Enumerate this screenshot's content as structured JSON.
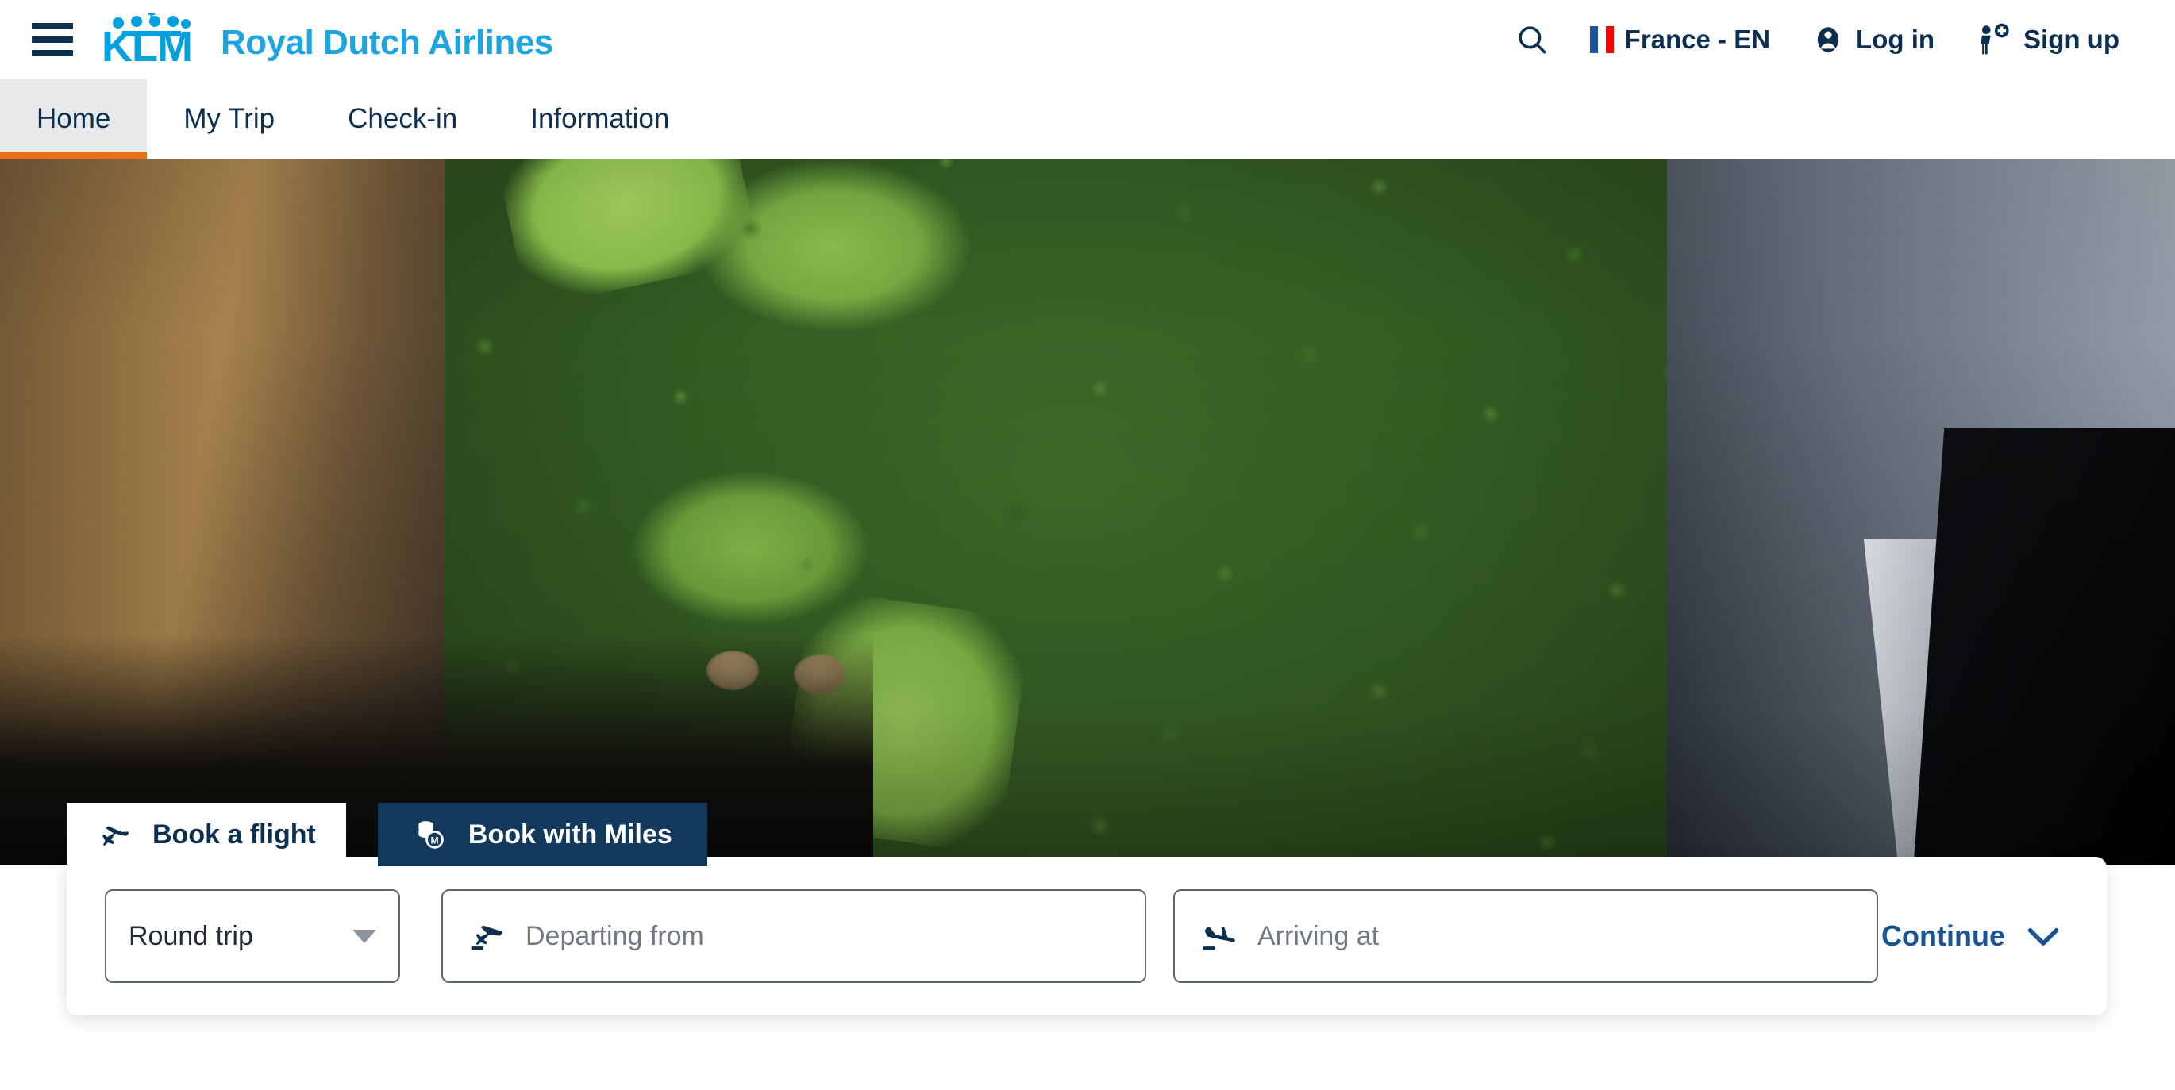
{
  "header": {
    "menu_icon": "hamburger-menu-icon",
    "logo": {
      "mark_text": "KLM",
      "brand_text": "Royal Dutch Airlines"
    },
    "search_icon": "search-icon",
    "locale": {
      "label": "France - EN",
      "flag": "france-flag-icon"
    },
    "login": {
      "label": "Log in",
      "icon": "user-account-icon"
    },
    "signup": {
      "label": "Sign up",
      "icon": "user-add-icon"
    }
  },
  "nav": {
    "tabs": [
      {
        "label": "Home",
        "active": true
      },
      {
        "label": "My Trip",
        "active": false
      },
      {
        "label": "Check-in",
        "active": false
      },
      {
        "label": "Information",
        "active": false
      }
    ]
  },
  "hero": {
    "alt": "Aerial view of Central Park and Manhattan skyline at golden hour"
  },
  "booking": {
    "tabs": [
      {
        "label": "Book a flight",
        "icon": "airplane-icon",
        "active": true
      },
      {
        "label": "Book with Miles",
        "icon": "miles-coins-icon",
        "active": false
      }
    ],
    "trip_type": {
      "value": "Round trip",
      "icon": "chevron-down-icon"
    },
    "departing": {
      "placeholder": "Departing from",
      "icon": "plane-takeoff-icon",
      "value": ""
    },
    "arriving": {
      "placeholder": "Arriving at",
      "icon": "plane-landing-icon",
      "value": ""
    },
    "continue": {
      "label": "Continue",
      "icon": "chevron-down-icon"
    }
  },
  "colors": {
    "klm_blue": "#00A1DE",
    "brand_light_blue": "#1EA4E0",
    "navy": "#0d2f4f",
    "miles_tab_bg": "#133A5C",
    "accent_orange": "#E8701A",
    "link_blue": "#1A5494",
    "active_tab_bg": "#E7E9EB"
  }
}
